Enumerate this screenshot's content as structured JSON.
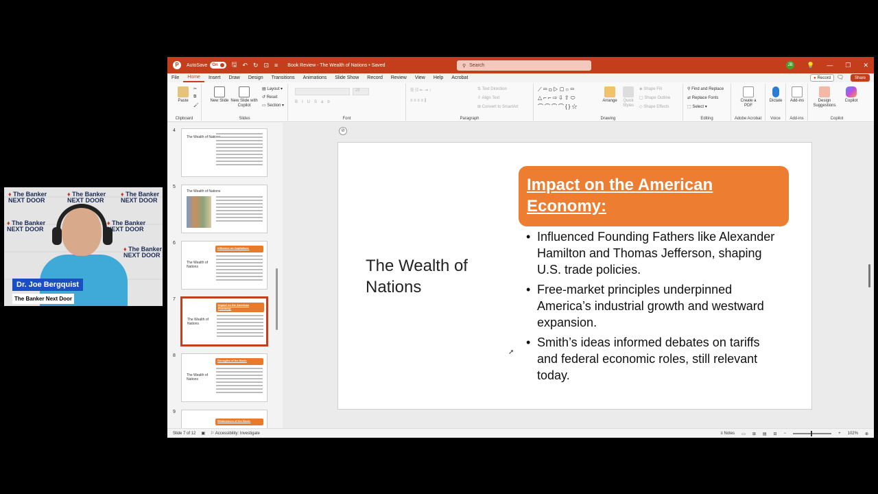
{
  "webcam": {
    "name": "Dr. Joe Bergquist",
    "subtitle": "The Banker Next Door",
    "logo_text": "The Banker NEXT DOOR"
  },
  "titlebar": {
    "autosave_label": "AutoSave",
    "autosave_state": "On",
    "doc_title": "Book Review - The Wealth of Nations • Saved",
    "search_placeholder": "Search",
    "avatar_initials": "JB"
  },
  "menu": {
    "items": [
      "File",
      "Home",
      "Insert",
      "Draw",
      "Design",
      "Transitions",
      "Animations",
      "Slide Show",
      "Record",
      "Review",
      "View",
      "Help",
      "Acrobat"
    ],
    "active": "Home",
    "record_label": "Record",
    "share_label": "Share"
  },
  "ribbon": {
    "clipboard": {
      "paste": "Paste",
      "label": "Clipboard"
    },
    "slides": {
      "new_slide": "New Slide",
      "new_slide_copilot": "New Slide with Copilot",
      "layout": "Layout",
      "reset": "Reset",
      "section": "Section",
      "label": "Slides"
    },
    "font": {
      "label": "Font",
      "size": "28"
    },
    "paragraph": {
      "text_direction": "Text Direction",
      "align_text": "Align Text",
      "convert_smartart": "Convert to SmartArt",
      "label": "Paragraph"
    },
    "drawing": {
      "arrange": "Arrange",
      "quick_styles": "Quick Styles",
      "shape_fill": "Shape Fill",
      "shape_outline": "Shape Outline",
      "shape_effects": "Shape Effects",
      "label": "Drawing"
    },
    "editing": {
      "find_replace": "Find and Replace",
      "replace_fonts": "Replace Fonts",
      "select": "Select",
      "label": "Editing"
    },
    "acrobat": {
      "create_pdf": "Create a PDF",
      "label": "Adobe Acrobat"
    },
    "voice": {
      "dictate": "Dictate",
      "label": "Voice"
    },
    "addins": {
      "addins": "Add-ins",
      "label": "Add-ins"
    },
    "design": {
      "suggestions": "Design Suggestions"
    },
    "copilot": {
      "copilot": "Copilot",
      "label": "Copilot"
    }
  },
  "thumbnails": [
    {
      "num": "4",
      "title": "The Wealth of Nations",
      "header": ""
    },
    {
      "num": "5",
      "title": "The Wealth of Nations",
      "header": ""
    },
    {
      "num": "6",
      "title": "The Wealth of Nations",
      "header": "Influence on Capitalism:"
    },
    {
      "num": "7",
      "title": "The Wealth of Nations",
      "header": "Impact on the American Economy:"
    },
    {
      "num": "8",
      "title": "The Wealth of Nations",
      "header": "Strengths of the Book:"
    },
    {
      "num": "9",
      "title": "",
      "header": "Weaknesses of the Book:"
    }
  ],
  "slide": {
    "title": "The Wealth of Nations",
    "banner_line1": "Impact on the American",
    "banner_line2": "Economy:",
    "bullets": [
      "Influenced Founding Fathers like Alexander Hamilton and Thomas Jefferson, shaping U.S. trade policies.",
      "Free-market principles underpinned America’s industrial growth and westward expansion.",
      "Smith’s ideas informed debates on tariffs and federal economic roles, still relevant today."
    ],
    "accent_color": "#ed7d31"
  },
  "status": {
    "slide_counter": "Slide 7 of 12",
    "accessibility": "Accessibility: Investigate",
    "notes": "Notes",
    "zoom": "102%"
  }
}
